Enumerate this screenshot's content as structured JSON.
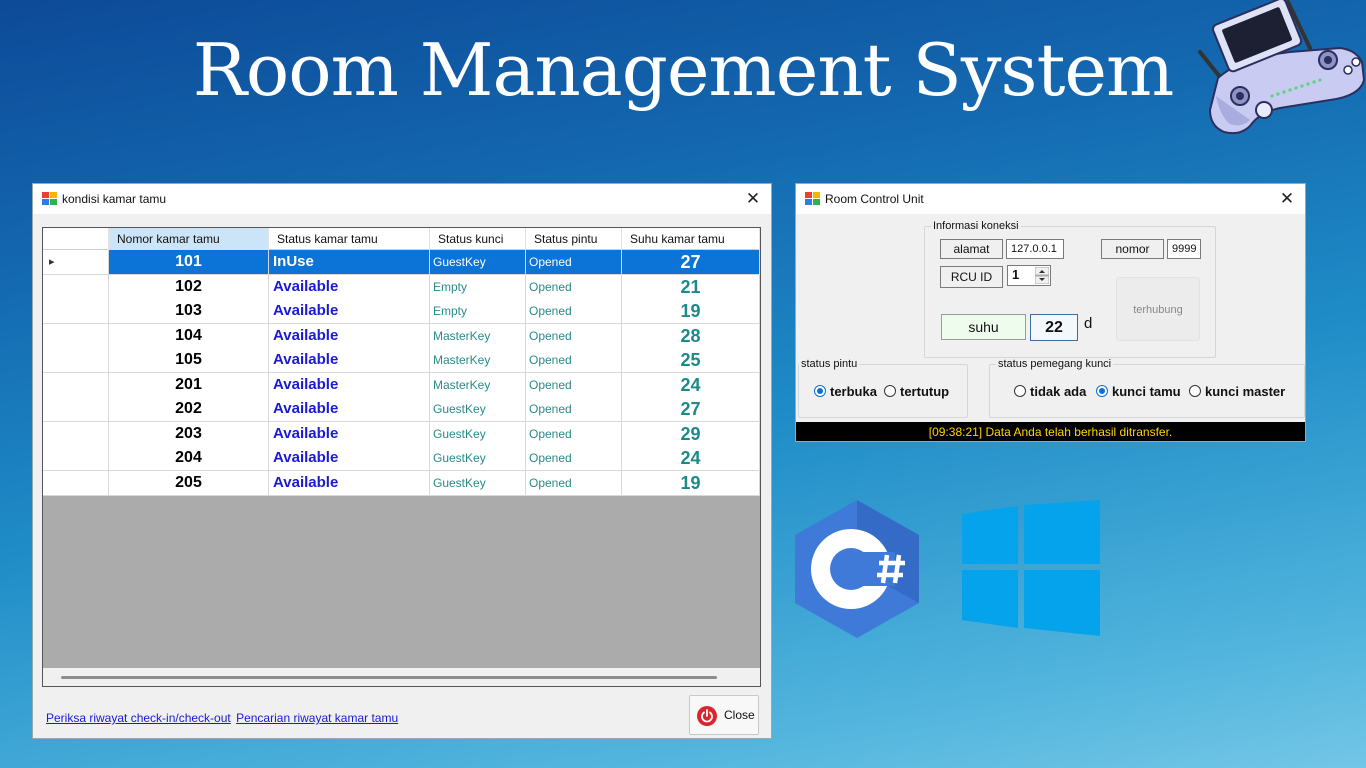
{
  "banner": {
    "title": "Room Management System"
  },
  "left_window": {
    "title": "kondisi kamar tamu",
    "close_glyph": "✕",
    "columns": [
      "Nomor kamar tamu",
      "Status kamar tamu",
      "Status kunci",
      "Status pintu",
      "Suhu kamar tamu"
    ],
    "rows": [
      {
        "room": "101",
        "status": "InUse",
        "key": "GuestKey",
        "door": "Opened",
        "temp": "27"
      },
      {
        "room": "102",
        "status": "Available",
        "key": "Empty",
        "door": "Opened",
        "temp": "21"
      },
      {
        "room": "103",
        "status": "Available",
        "key": "Empty",
        "door": "Opened",
        "temp": "19"
      },
      {
        "room": "104",
        "status": "Available",
        "key": "MasterKey",
        "door": "Opened",
        "temp": "28"
      },
      {
        "room": "105",
        "status": "Available",
        "key": "MasterKey",
        "door": "Opened",
        "temp": "25"
      },
      {
        "room": "201",
        "status": "Available",
        "key": "MasterKey",
        "door": "Opened",
        "temp": "24"
      },
      {
        "room": "202",
        "status": "Available",
        "key": "GuestKey",
        "door": "Opened",
        "temp": "27"
      },
      {
        "room": "203",
        "status": "Available",
        "key": "GuestKey",
        "door": "Opened",
        "temp": "29"
      },
      {
        "room": "204",
        "status": "Available",
        "key": "GuestKey",
        "door": "Opened",
        "temp": "24"
      },
      {
        "room": "205",
        "status": "Available",
        "key": "GuestKey",
        "door": "Opened",
        "temp": "19"
      }
    ],
    "selected_row": "101",
    "links": [
      "Periksa riwayat check-in/check-out",
      "Pencarian riwayat kamar tamu"
    ],
    "close_button": "Close"
  },
  "right_window": {
    "title": "Room Control Unit",
    "close_glyph": "✕",
    "connection_group": "Informasi koneksi",
    "address_label": "alamat",
    "address_value": "127.0.0.1",
    "number_label": "nomor",
    "number_value": "9999",
    "rcu_label": "RCU ID",
    "rcu_value": "1",
    "temp_label": "suhu",
    "temp_value": "22",
    "temp_unit": "d",
    "connection_status": "terhubung",
    "door_group": "status pintu",
    "door_options": [
      {
        "label": "terbuka",
        "checked": true
      },
      {
        "label": "tertutup",
        "checked": false
      }
    ],
    "key_group": "status pemegang kunci",
    "key_options": [
      {
        "label": "tidak ada",
        "checked": false
      },
      {
        "label": "kunci tamu",
        "checked": true
      },
      {
        "label": "kunci master",
        "checked": false
      }
    ],
    "status_message": "[09:38:21] Data Anda telah berhasil ditransfer."
  },
  "colors": {
    "selected_row": "#0b74d6",
    "status_text": "#1a1ad6",
    "teal_text": "#1b8a88",
    "status_bar_text": "#ffd400"
  },
  "icons": [
    "app-window-icon",
    "power-icon",
    "game-controller-icon",
    "csharp-logo-icon",
    "windows-logo-icon"
  ]
}
